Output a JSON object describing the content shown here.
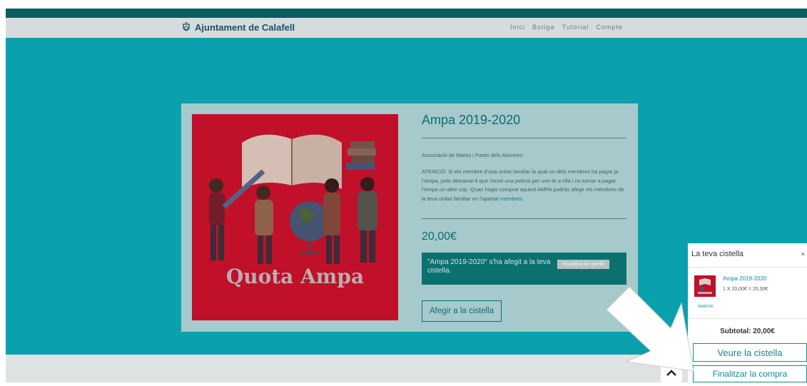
{
  "header": {
    "logo_text": "Ajuntament de Calafell",
    "nav": [
      "Inici",
      "Botiga",
      "Tutorial",
      "Compte"
    ]
  },
  "product": {
    "image_text": "Quota Ampa",
    "title": "Ampa 2019-2020",
    "subtitle": "Associació de Mares i Pares dels Alumnes",
    "note_text": "ATENCIÓ: Si ets membre d'una unitat familiar la qual un dels membres ha pagat ja l'Ampa, pots demanar-li que t'envii una petició per unir-te a ella i no tornar a pagar l'Ampa un altre cop. Quan hagis comprat aquest AMPA podràs afegir els membres de la teva unitat familiar en l'apartat",
    "note_link": "membres",
    "note_end": ".",
    "price": "20,00€",
    "notice_text": "\"Ampa 2019-2020\" s'ha afegit a la teva cistella.",
    "notice_button": "Visualitza la cistella",
    "add_button": "Afegir a la cistella"
  },
  "minicart": {
    "title": "La teva cistella",
    "close": "×",
    "item_name": "Ampa 2019-2020",
    "item_qty": "1 X 20,00€ = 20,00€",
    "remove": "REMOVE",
    "subtotal": "Subtotal: 20,00€",
    "view_button": "Veure la cistella",
    "checkout_button": "Finalitzar la compra"
  },
  "icons": {
    "logo": "coat-of-arms-icon",
    "arrow": "pointer-arrow-icon"
  },
  "colors": {
    "hero": "#0aa0ad",
    "brand_dark": "#0b5e5e",
    "accent": "#0b8d96",
    "product_bg": "#c0102a"
  }
}
